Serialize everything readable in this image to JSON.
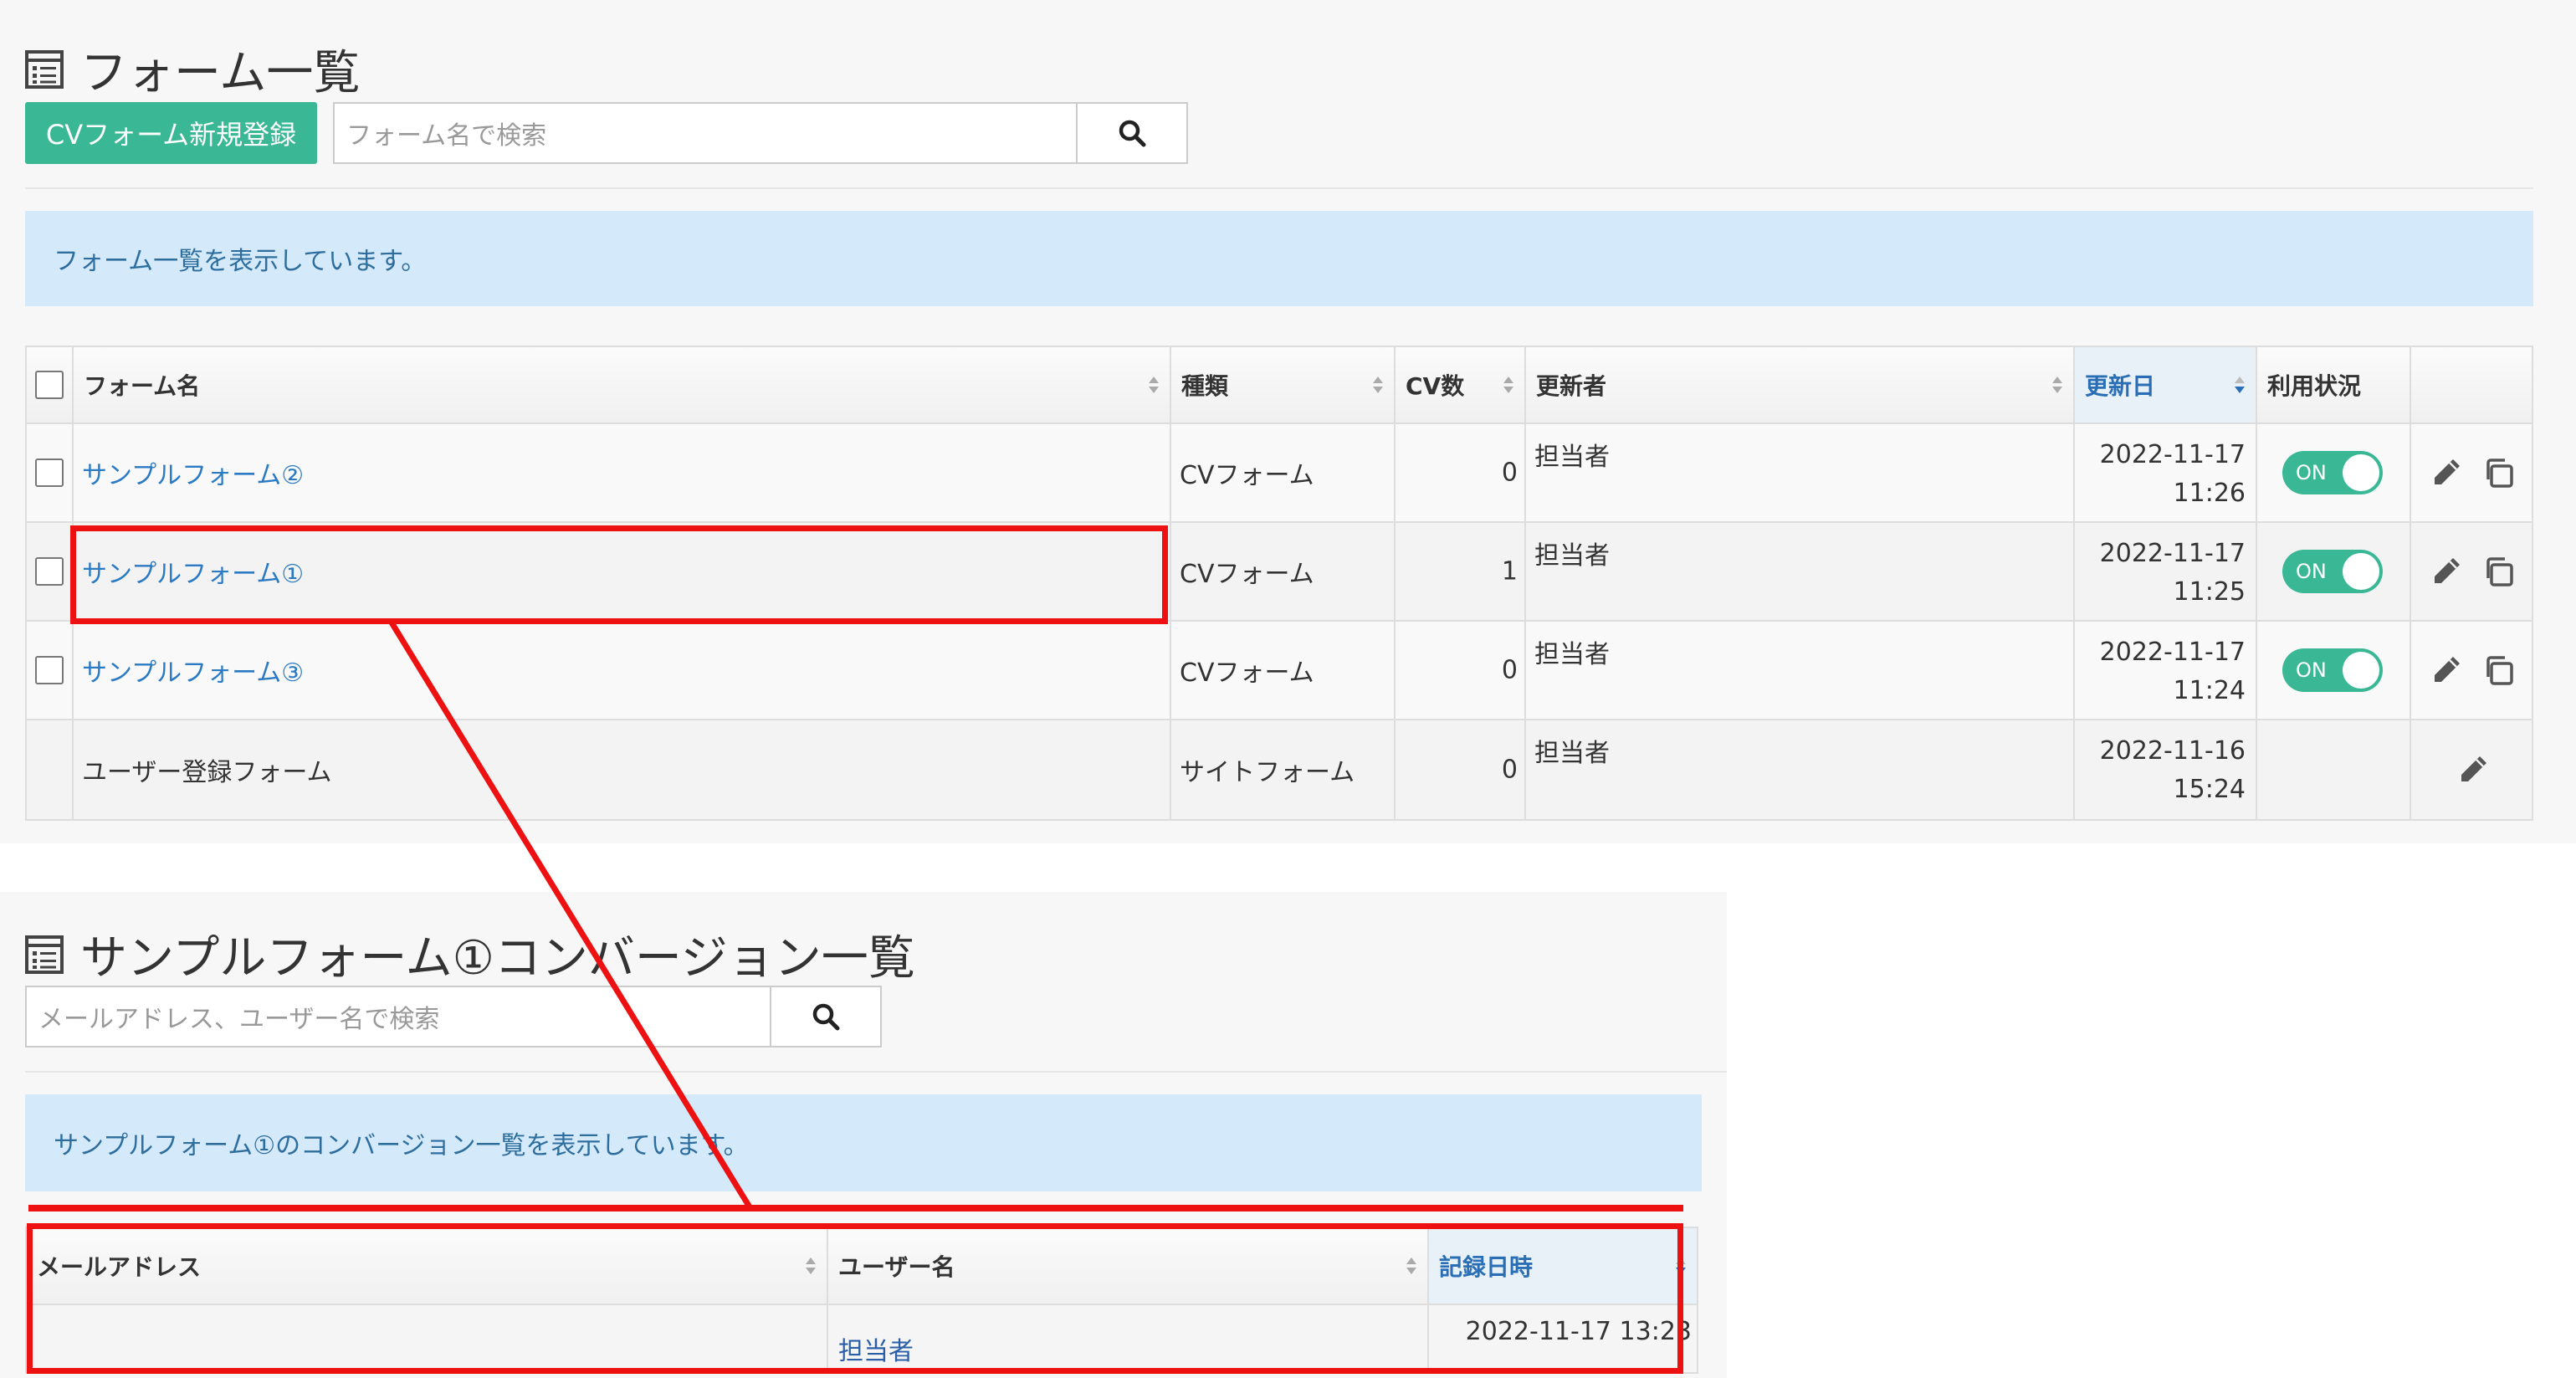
{
  "top": {
    "title": "フォーム一覧",
    "new_button": "CVフォーム新規登録",
    "search_placeholder": "フォーム名で検索",
    "alert": "フォーム一覧を表示しています。",
    "columns": [
      "フォーム名",
      "種類",
      "CV数",
      "更新者",
      "更新日",
      "利用状況"
    ],
    "rows": [
      {
        "name": "サンプルフォーム②",
        "type": "CVフォーム",
        "cv": "0",
        "updater": "担当者",
        "date": "2022-11-17",
        "time": "11:26",
        "status": "ON"
      },
      {
        "name": "サンプルフォーム①",
        "type": "CVフォーム",
        "cv": "1",
        "updater": "担当者",
        "date": "2022-11-17",
        "time": "11:25",
        "status": "ON"
      },
      {
        "name": "サンプルフォーム③",
        "type": "CVフォーム",
        "cv": "0",
        "updater": "担当者",
        "date": "2022-11-17",
        "time": "11:24",
        "status": "ON"
      },
      {
        "name": "ユーザー登録フォーム",
        "type": "サイトフォーム",
        "cv": "0",
        "updater": "担当者",
        "date": "2022-11-16",
        "time": "15:24",
        "status": ""
      }
    ]
  },
  "bottom": {
    "title": "サンプルフォーム①コンバージョン一覧",
    "search_placeholder": "メールアドレス、ユーザー名で検索",
    "alert": "サンプルフォーム①のコンバージョン一覧を表示しています。",
    "columns": [
      "メールアドレス",
      "ユーザー名",
      "記録日時"
    ],
    "rows": [
      {
        "email": "",
        "user": "担当者",
        "datetime": "2022-11-17 13:23"
      }
    ]
  },
  "colors": {
    "accent": "#3ab795",
    "link": "#2a7ac4",
    "alert_bg": "#d4e9f9",
    "annotation": "#ee1111"
  }
}
